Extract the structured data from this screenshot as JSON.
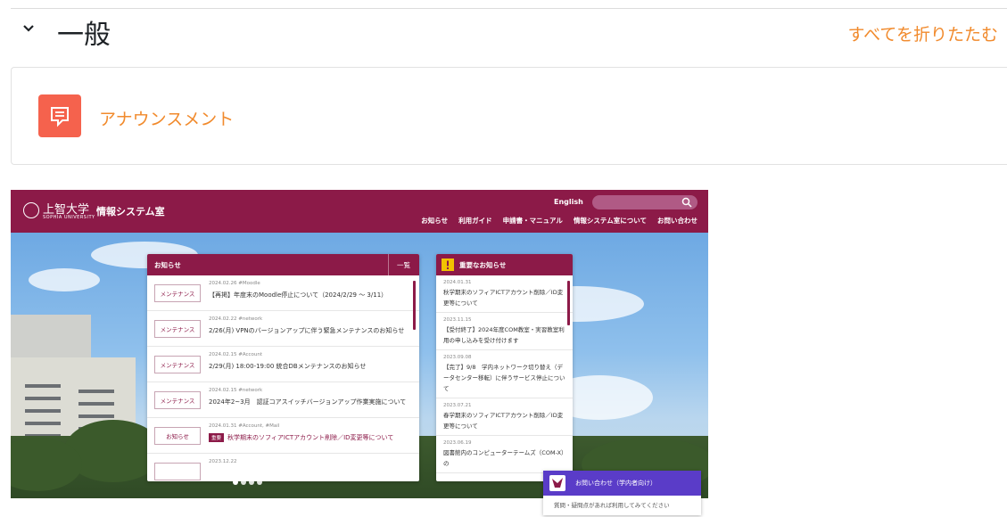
{
  "section": {
    "title": "一般",
    "collapse_all": "すべてを折りたたむ"
  },
  "activity": {
    "label": "アナウンスメント",
    "icon": "announcement-icon",
    "icon_color": "#f5624d",
    "link_color": "#f18a2c"
  },
  "banner": {
    "logo_text": "上智大学",
    "logo_sub": "SOPHIA UNIVERSITY",
    "site_title": "情報システム室",
    "lang": "English",
    "brand_color": "#8c1a48",
    "nav": [
      "お知らせ",
      "利用ガイド",
      "申請書・マニュアル",
      "情報システム室について",
      "お問い合わせ"
    ],
    "news_panel": {
      "title": "お知らせ",
      "more": "一覧",
      "items": [
        {
          "tag": "メンテナンス",
          "meta": "2024.02.26 #Moodle",
          "title": "【再掲】年度末のMoodle停止について（2024/2/29 ～ 3/11）",
          "important": false
        },
        {
          "tag": "メンテナンス",
          "meta": "2024.02.22 #network",
          "title": "2/26(月) VPNのバージョンアップに伴う緊急メンテナンスのお知らせ",
          "important": false
        },
        {
          "tag": "メンテナンス",
          "meta": "2024.02.15 #Account",
          "title": "2/29(月) 18:00-19:00 統合DBメンテナンスのお知らせ",
          "important": false
        },
        {
          "tag": "メンテナンス",
          "meta": "2024.02.15 #network",
          "title": "2024年2~3月　認証コアスイッチバージョンアップ作業実施について",
          "important": false
        },
        {
          "tag": "お知らせ",
          "meta": "2024.01.31 #Account, #Mail",
          "title": "秋学期末のソフィアICTアカウント削除／ID変更等について",
          "important": true,
          "badge": "重要"
        },
        {
          "tag": "",
          "meta": "2023.12.22",
          "title": "",
          "important": false
        }
      ]
    },
    "important_panel": {
      "title": "重要なお知らせ",
      "icon": "warning-icon",
      "items": [
        {
          "date": "2024.01.31",
          "text": "秋学期末のソフィアICTアカウント削除／ID変更等について"
        },
        {
          "date": "2023.11.15",
          "text": "【受付終了】2024年度COM教室・実習教室利用の申し込みを受け付けます"
        },
        {
          "date": "2023.09.08",
          "text": "【完了】9/8　学内ネットワーク切り替え（データセンター移転）に伴うサービス停止について"
        },
        {
          "date": "2023.07.21",
          "text": "春学期末のソフィアICTアカウント削除／ID変更等について"
        },
        {
          "date": "2023.06.19",
          "text": "図書館内のコンピューターテームズ（COM-X）の"
        }
      ]
    },
    "contact": {
      "title": "お問い合わせ（学内者向け）",
      "sub": "質問・疑問点があれば利用してみてください",
      "color": "#5a3cc8"
    }
  }
}
